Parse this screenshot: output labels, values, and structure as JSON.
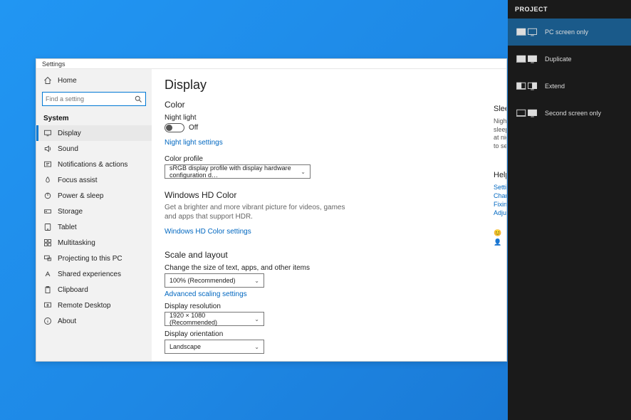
{
  "window_title": "Settings",
  "home_label": "Home",
  "search_placeholder": "Find a setting",
  "section": "System",
  "nav": [
    {
      "label": "Display"
    },
    {
      "label": "Sound"
    },
    {
      "label": "Notifications & actions"
    },
    {
      "label": "Focus assist"
    },
    {
      "label": "Power & sleep"
    },
    {
      "label": "Storage"
    },
    {
      "label": "Tablet"
    },
    {
      "label": "Multitasking"
    },
    {
      "label": "Projecting to this PC"
    },
    {
      "label": "Shared experiences"
    },
    {
      "label": "Clipboard"
    },
    {
      "label": "Remote Desktop"
    },
    {
      "label": "About"
    }
  ],
  "page": {
    "title": "Display",
    "color_header": "Color",
    "night_light_label": "Night light",
    "night_light_state": "Off",
    "night_light_link": "Night light settings",
    "color_profile_label": "Color profile",
    "color_profile_value": "sRGB display profile with display hardware configuration d…",
    "hd_header": "Windows HD Color",
    "hd_desc": "Get a brighter and more vibrant picture for videos, games and apps that support HDR.",
    "hd_link": "Windows HD Color settings",
    "scale_header": "Scale and layout",
    "scale_label": "Change the size of text, apps, and other items",
    "scale_value": "100% (Recommended)",
    "scale_link": "Advanced scaling settings",
    "res_label": "Display resolution",
    "res_value": "1920 × 1080 (Recommended)",
    "orient_label": "Display orientation",
    "orient_value": "Landscape"
  },
  "side_panel": {
    "sleep_header": "Sleep",
    "sleep_desc_1": "Nigh",
    "sleep_desc_2": "sleep",
    "sleep_desc_3": "at nig",
    "sleep_desc_4": "to set",
    "help_header": "Help",
    "help_links": [
      "Setti",
      "Chan",
      "Fixin",
      "Adju"
    ],
    "feedback_icon1": "😊",
    "feedback_icon2": "👤"
  },
  "project": {
    "header": "PROJECT",
    "options": [
      {
        "label": "PC screen only"
      },
      {
        "label": "Duplicate"
      },
      {
        "label": "Extend"
      },
      {
        "label": "Second screen only"
      }
    ]
  }
}
